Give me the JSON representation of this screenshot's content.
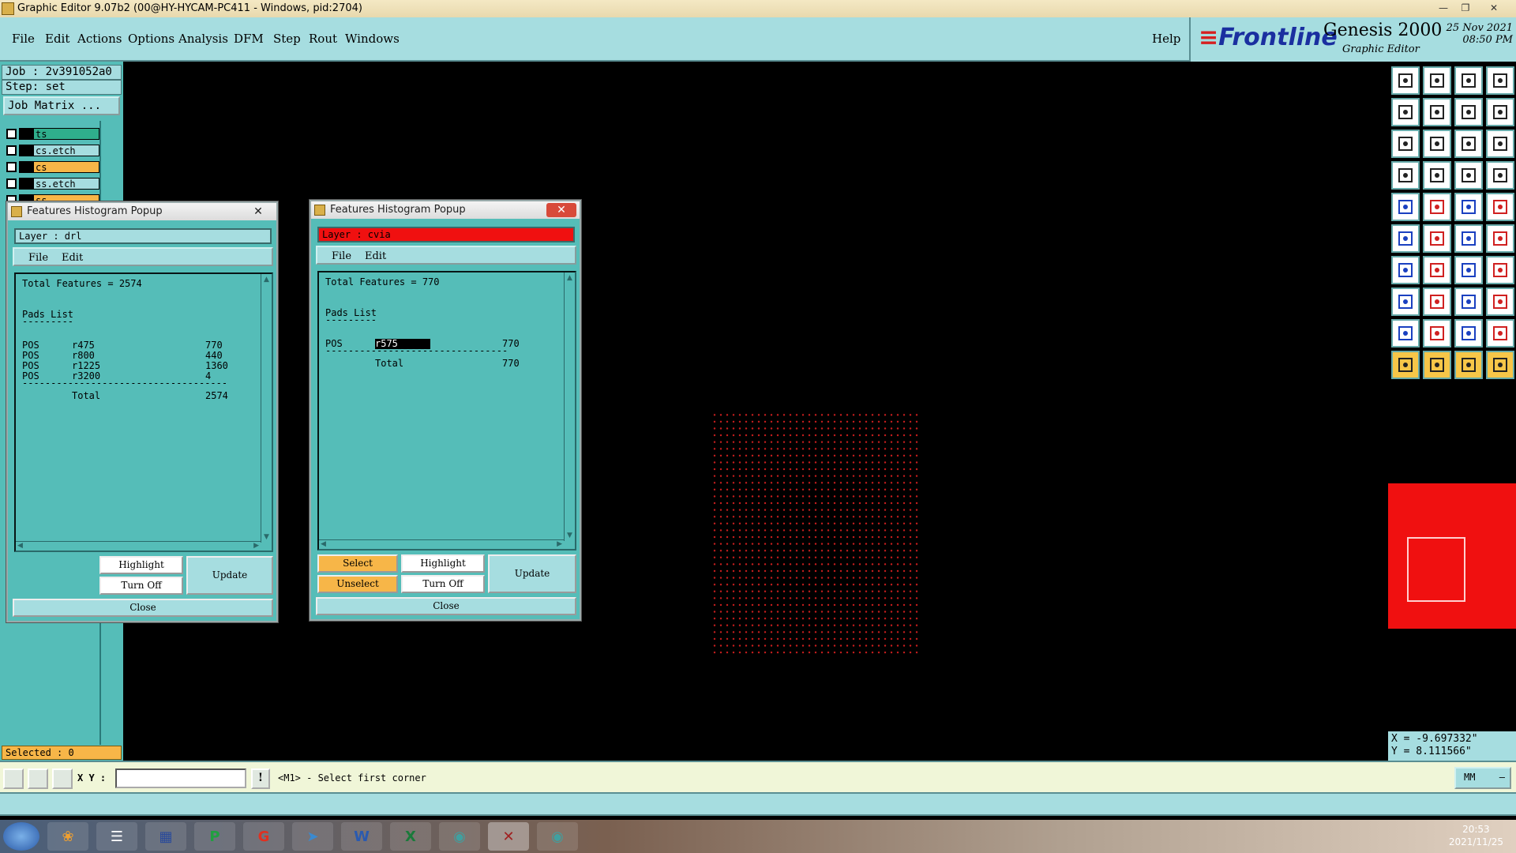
{
  "window": {
    "title": "Graphic Editor 9.07b2 (00@HY-HYCAM-PC411 - Windows, pid:2704)"
  },
  "menu": {
    "items": [
      "File",
      "Edit",
      "Actions",
      "Options",
      "Analysis",
      "DFM",
      "Step",
      "Rout",
      "Windows"
    ],
    "help": "Help"
  },
  "brand": {
    "logo": "Frontline",
    "product": "Genesis 2000",
    "subtitle": "Graphic Editor",
    "date": "25 Nov 2021",
    "time": "08:50 PM"
  },
  "job": {
    "job_label": "Job : 2v391052a0",
    "step_label": "Step: set",
    "matrix_button": "Job Matrix ..."
  },
  "layers": [
    {
      "name": "ts",
      "color": "#2fae8c"
    },
    {
      "name": "cs.etch",
      "color": "#a6dde0"
    },
    {
      "name": "cs",
      "color": "#f7b648"
    },
    {
      "name": "ss.etch",
      "color": "#a6dde0"
    },
    {
      "name": "ss",
      "color": "#f7b648"
    }
  ],
  "selected": "Selected : 0",
  "popup1": {
    "title": "Features Histogram Popup",
    "layer": "Layer :  drl",
    "menu_file": "File",
    "menu_edit": "Edit",
    "total": "Total Features = 2574",
    "list_title": "Pads List",
    "rows": [
      {
        "type": "POS",
        "sym": "r475",
        "count": "770"
      },
      {
        "type": "POS",
        "sym": "r800",
        "count": "440"
      },
      {
        "type": "POS",
        "sym": "r1225",
        "count": "1360"
      },
      {
        "type": "POS",
        "sym": "r3200",
        "count": "4"
      }
    ],
    "total_label": "Total",
    "total_value": "2574",
    "highlight": "Highlight",
    "turnoff": "Turn Off",
    "update": "Update",
    "close": "Close"
  },
  "popup2": {
    "title": "Features Histogram Popup",
    "layer": "Layer :  cvia",
    "menu_file": "File",
    "menu_edit": "Edit",
    "total": "Total Features = 770",
    "list_title": "Pads List",
    "rows": [
      {
        "type": "POS",
        "sym": "r575",
        "count": "770"
      }
    ],
    "total_label": "Total",
    "total_value": "770",
    "select": "Select",
    "unselect": "Unselect",
    "highlight": "Highlight",
    "turnoff": "Turn Off",
    "update": "Update",
    "close": "Close"
  },
  "coords": {
    "x": "X = -9.697332\"",
    "y": "Y = 8.111566\""
  },
  "command": {
    "xy_label": "X Y :",
    "xy_value": "",
    "message": "<M1> - Select first corner",
    "units": "MM"
  },
  "clock": {
    "time": "20:53",
    "date": "2021/11/25"
  },
  "colors": {
    "teal": "#55bdb8",
    "light_teal": "#a6dde0",
    "orange": "#f7b648",
    "red": "#f01010",
    "via": "#c81e1e"
  },
  "toolbar_icons": [
    "save-icon",
    "open-icon",
    "home-icon",
    "layout-icon",
    "prev-step-icon",
    "next-step-icon",
    "snap-icon",
    "route-icon",
    "fit-icon",
    "zoom-icon",
    "scale-icon",
    "help-icon",
    "drill-icon",
    "line-icon",
    "ruler-v-icon",
    "ruler-h-icon",
    "record-icon",
    "shape-icon",
    "measure-icon",
    "circle-icon",
    "node-icon",
    "cross-icon",
    "connect-icon",
    "link-icon",
    "slope-icon",
    "edit-line-icon",
    "arc-icon",
    "split-icon",
    "pad-icon",
    "minus-icon",
    "expand-icon",
    "copy-icon",
    "triangle-icon",
    "letter-a-icon",
    "letter-a2-icon",
    "letter-a3-icon",
    "pointer-icon",
    "select-icon",
    "pick-icon",
    "multi-icon"
  ]
}
